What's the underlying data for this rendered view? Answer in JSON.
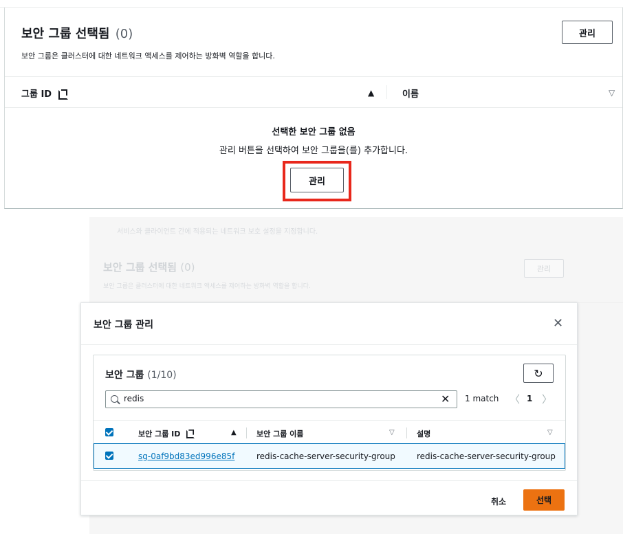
{
  "top_panel": {
    "title": "보안 그룹 선택됨",
    "count": "(0)",
    "description": "보안 그룹은 클러스터에 대한 네트워크 액세스를 제어하는 방화벽 역할을 합니다.",
    "manage_label": "관리",
    "table": {
      "col_group_id": "그룹 ID",
      "col_name": "이름",
      "sort_asc_glyph": "▲",
      "sort_desc_glyph": "▽"
    },
    "empty_title": "선택한 보안 그룹 없음",
    "empty_desc": "관리 버튼을 선택하여 보안 그룹을(를) 추가합니다.",
    "empty_manage_label": "관리",
    "highlight_color": "#e8281c"
  },
  "background_page": {
    "hint": "서비스와 클라이언트 간에 적용되는 네트워크 보호 설정을 지정합니다.",
    "title": "보안 그룹 선택됨",
    "count": "(0)",
    "description": "보안 그룹은 클러스터에 대한 네트워크 액세스를 제어하는 방화벽 역할을 합니다.",
    "manage_label": "관리"
  },
  "modal": {
    "title": "보안 그룹 관리",
    "close_glyph": "✕",
    "inner": {
      "title": "보안 그룹",
      "count": "(1/10)",
      "refresh_glyph": "↻",
      "search_value": "redis",
      "clear_glyph": "✕",
      "match_text": "1 match",
      "page_prev": "〈",
      "page_num": "1",
      "page_next": "〉",
      "columns": {
        "id": "보안 그룹 ID",
        "name": "보안 그룹 이름",
        "desc": "설명"
      },
      "sort_asc_glyph": "▲",
      "sort_desc_glyph": "▽",
      "rows": [
        {
          "id": "sg-0af9bd83ed996e85f",
          "name": "redis-cache-server-security-group",
          "desc": "redis-cache-server-security-group",
          "checked": true
        }
      ]
    },
    "cancel_label": "취소",
    "select_label": "선택",
    "primary_color": "#ec7211",
    "selected_row_border": "#0073bb"
  }
}
